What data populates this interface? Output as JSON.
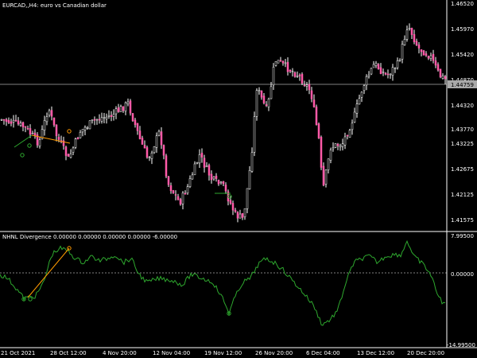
{
  "main_title": "EURCAD,,H4:  euro vs Canadian dollar",
  "indicator_title": "NHNL Divergence 0.00000 0.00000 0.00000 0.00000 -6.00000",
  "price_current": "1.44759",
  "price_ticks": [
    "1.46520",
    "1.45970",
    "1.45420",
    "1.44870",
    "1.44320",
    "1.43770",
    "1.43225",
    "1.42675",
    "1.42125",
    "1.41575"
  ],
  "ind_ticks": [
    "7.99500",
    "0.00000",
    "-14.99500"
  ],
  "time_ticks": [
    "21 Oct 2021",
    "28 Oct 12:00",
    "4 Nov 20:00",
    "12 Nov 04:00",
    "19 Nov 12:00",
    "26 Nov 20:00",
    "6 Dec 04:00",
    "13 Dec 12:00",
    "20 Dec 20:00"
  ],
  "colors": {
    "background": "#000000",
    "axis": "#ffffff",
    "bull": "#000000",
    "bear": "#ff5aa8",
    "wick": "#ffffff",
    "indicator": "#2ea82e",
    "divergence": "#ff9a00",
    "divergence_ghost": "#2ea82e",
    "zero_line": "#808080",
    "current_price_line": "#808080",
    "current_price_tag": "#a9a9a9"
  }
}
